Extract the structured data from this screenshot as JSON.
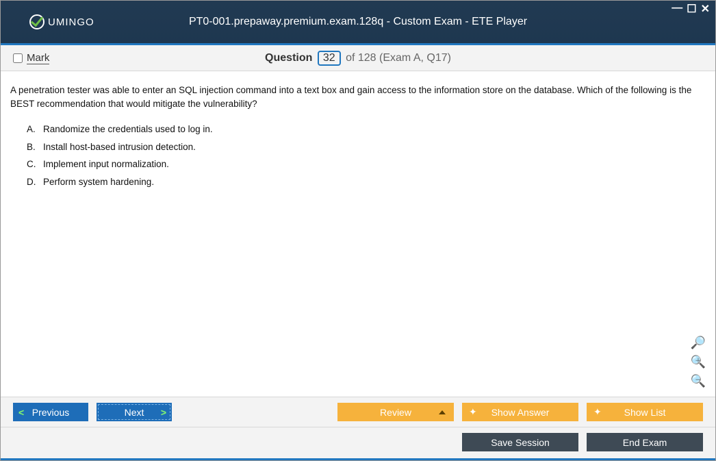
{
  "window": {
    "title": "PT0-001.prepaway.premium.exam.128q - Custom Exam - ETE Player",
    "logo_text": "UMINGO"
  },
  "header": {
    "mark_label": "Mark",
    "question_label": "Question",
    "current_number": "32",
    "of_text": "of 128 (Exam A, Q17)"
  },
  "question": {
    "text": "A penetration tester was able to enter an SQL injection command into a text box and gain access to the information store on the database. Which of the following is the BEST recommendation that would mitigate the vulnerability?",
    "options": [
      {
        "letter": "A.",
        "text": "Randomize the credentials used to log in."
      },
      {
        "letter": "B.",
        "text": "Install host-based intrusion detection."
      },
      {
        "letter": "C.",
        "text": "Implement input normalization."
      },
      {
        "letter": "D.",
        "text": "Perform system hardening."
      }
    ]
  },
  "toolbar": {
    "previous": "Previous",
    "next": "Next",
    "review": "Review",
    "show_answer": "Show Answer",
    "show_list": "Show List"
  },
  "bottom": {
    "save_session": "Save Session",
    "end_exam": "End Exam"
  }
}
